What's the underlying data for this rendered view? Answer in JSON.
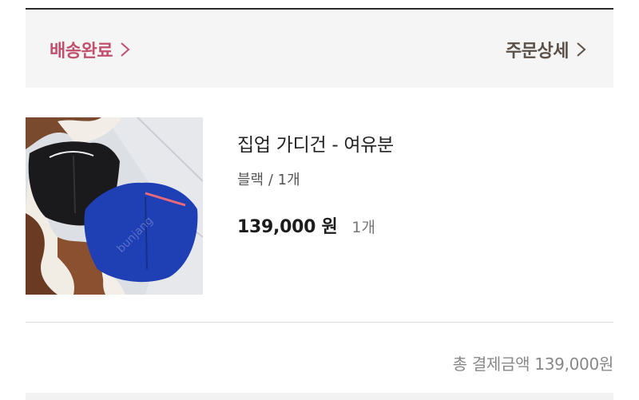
{
  "order_header": {
    "status_label": "배송완료",
    "detail_label": "주문상세"
  },
  "product": {
    "name": "집업 가디건 - 여유분",
    "option": "블랙 / 1개",
    "price": "139,000 원",
    "quantity": "1개",
    "image_icon": "cardigan-photo"
  },
  "summary": {
    "total_text": "총 결제금액 139,000원"
  },
  "colors": {
    "status_accent": "#c0506e",
    "detail_text": "#5a5048",
    "header_bg": "#f5f5f5"
  }
}
